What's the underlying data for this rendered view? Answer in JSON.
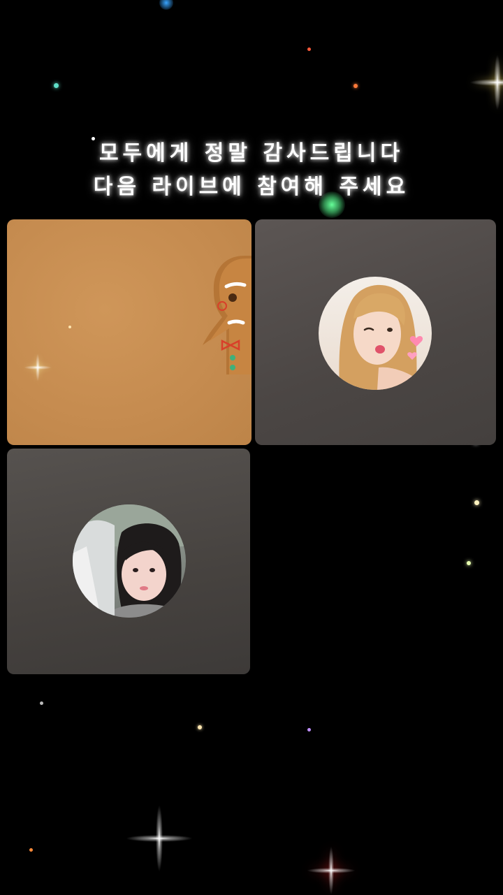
{
  "message": {
    "line1": "모두에게 정말 감사드립니다",
    "line2": "다음 라이브에 참여해 주세요"
  },
  "participants": [
    {
      "id": "participant-1",
      "content": "gingerbread-sticker",
      "avatar": null
    },
    {
      "id": "participant-2",
      "content": "avatar",
      "avatar": "profile-photo-winking-woman"
    },
    {
      "id": "participant-3",
      "content": "avatar",
      "avatar": "profile-photo-woman-in-car"
    }
  ],
  "colors": {
    "background": "#000000",
    "tile_orange": "#c58b4f",
    "tile_gray": "#4b4644",
    "text": "#ffffff"
  }
}
